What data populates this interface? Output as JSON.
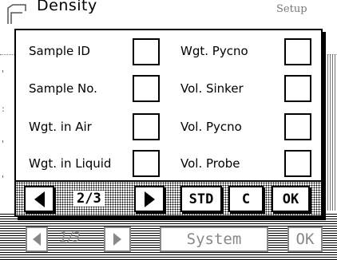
{
  "background": {
    "title": "Density",
    "setup_label": "Setup",
    "page_indicator": "1/3",
    "system_label": "System",
    "ok_label": "OK"
  },
  "dialog": {
    "left_fields": [
      {
        "label": "Sample ID",
        "checked": false
      },
      {
        "label": "Sample No.",
        "checked": false
      },
      {
        "label": "Wgt. in Air",
        "checked": false
      },
      {
        "label": "Wgt. in Liquid",
        "checked": false
      }
    ],
    "right_fields": [
      {
        "label": "Wgt. Pycno",
        "checked": false
      },
      {
        "label": "Vol. Sinker",
        "checked": false
      },
      {
        "label": "Vol. Pycno",
        "checked": false
      },
      {
        "label": "Vol. Probe",
        "checked": false
      }
    ],
    "footer": {
      "page_indicator": "2/3",
      "std_label": "STD",
      "c_label": "C",
      "ok_label": "OK"
    }
  }
}
